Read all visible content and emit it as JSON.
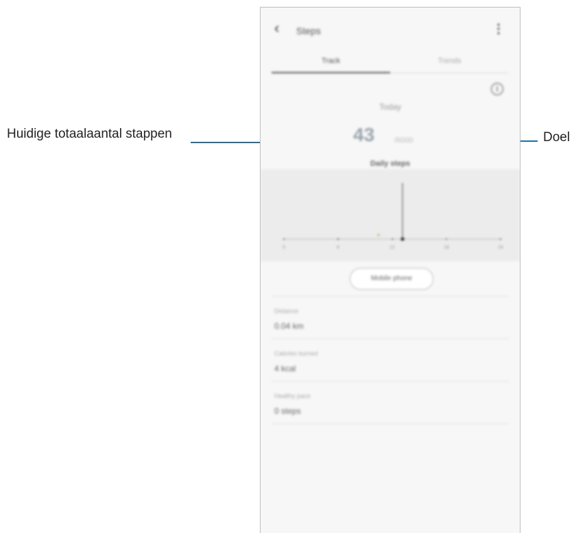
{
  "callouts": {
    "left_label": "Huidige totaalaantal stappen",
    "right_label": "Doel"
  },
  "app": {
    "title": "Steps",
    "back_icon": "chevron-left-icon",
    "more_icon": "more-vertical-icon",
    "tabs": [
      {
        "label": "Track",
        "selected": true
      },
      {
        "label": "Trends",
        "selected": false
      }
    ],
    "info_icon": "info-icon",
    "today_label": "Today",
    "current_steps": "43",
    "goal_text": "/6000",
    "daily_steps_label": "Daily steps",
    "chart_ticks": [
      "0",
      "6",
      "12",
      "18",
      "24"
    ],
    "device_button": "Mobile phone",
    "stats": [
      {
        "label": "Distance",
        "value": "0.04 km"
      },
      {
        "label": "Calories burned",
        "value": "4 kcal"
      },
      {
        "label": "Healthy pace",
        "value": "0 steps"
      }
    ]
  }
}
